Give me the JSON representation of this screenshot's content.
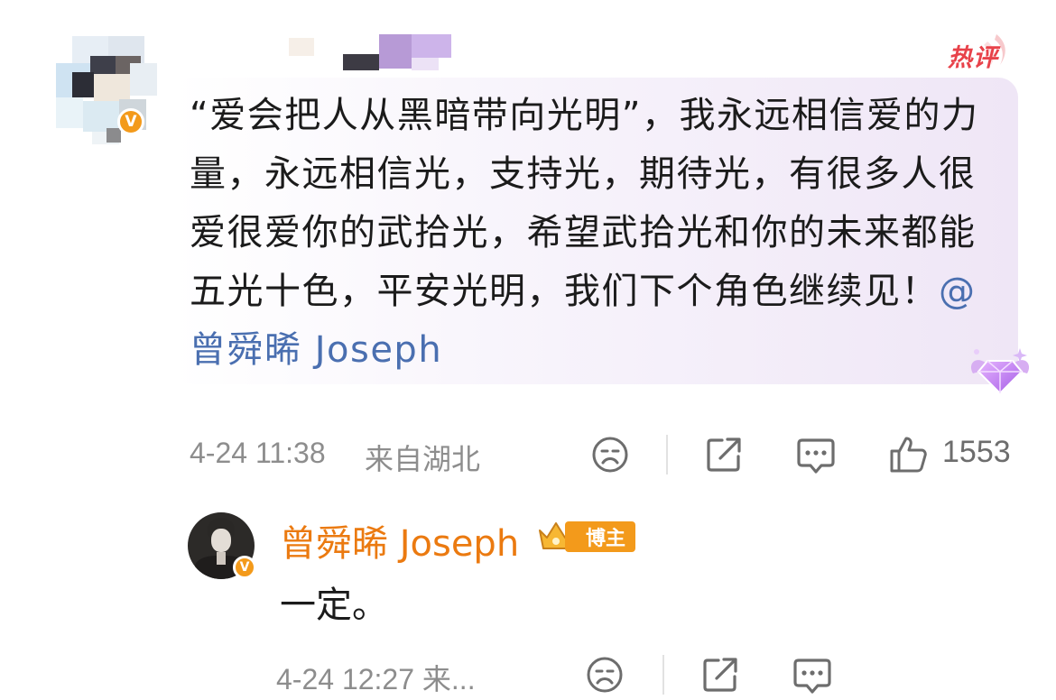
{
  "hot_label": "热评",
  "main_comment": {
    "text": "“爱会把人从黑暗带向光明”，我永远相信爱的力量，永远相信光，支持光，期待光，有很多人很爱很爱你的武拾光，希望武拾光和你的未来都能五光十色，平安光明，我们下个角色继续见！",
    "mention": "@曾舜晞 Joseph",
    "time": "4-24 11:38",
    "location": "来自湖北",
    "like_count": "1553"
  },
  "reply": {
    "author": "曾舜晞 Joseph",
    "owner_tag": "博主",
    "text": "一定。",
    "time_location": "4-24 12:27 来..."
  },
  "icons": [
    "dislike-icon",
    "share-icon",
    "comment-icon",
    "like-icon",
    "verified-icon",
    "crown-icon",
    "gem-badge-icon"
  ],
  "colors": {
    "accent_orange": "#eb7a10",
    "verified_badge": "#f39a1b",
    "hot_red": "#e8424a",
    "mention_blue": "#4a6fb0",
    "meta_gray": "#8d8d8d"
  }
}
